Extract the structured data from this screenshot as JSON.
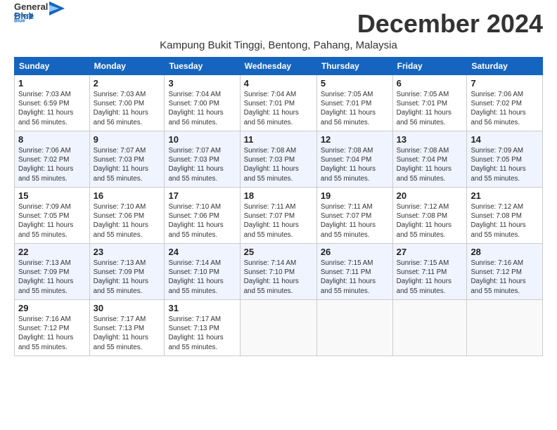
{
  "logo": {
    "general": "General",
    "blue": "Blue",
    "tagline": ""
  },
  "header": {
    "month_year": "December 2024",
    "location": "Kampung Bukit Tinggi, Bentong, Pahang, Malaysia"
  },
  "weekdays": [
    "Sunday",
    "Monday",
    "Tuesday",
    "Wednesday",
    "Thursday",
    "Friday",
    "Saturday"
  ],
  "weeks": [
    [
      {
        "day": "1",
        "info": "Sunrise: 7:03 AM\nSunset: 6:59 PM\nDaylight: 11 hours\nand 56 minutes."
      },
      {
        "day": "2",
        "info": "Sunrise: 7:03 AM\nSunset: 7:00 PM\nDaylight: 11 hours\nand 56 minutes."
      },
      {
        "day": "3",
        "info": "Sunrise: 7:04 AM\nSunset: 7:00 PM\nDaylight: 11 hours\nand 56 minutes."
      },
      {
        "day": "4",
        "info": "Sunrise: 7:04 AM\nSunset: 7:01 PM\nDaylight: 11 hours\nand 56 minutes."
      },
      {
        "day": "5",
        "info": "Sunrise: 7:05 AM\nSunset: 7:01 PM\nDaylight: 11 hours\nand 56 minutes."
      },
      {
        "day": "6",
        "info": "Sunrise: 7:05 AM\nSunset: 7:01 PM\nDaylight: 11 hours\nand 56 minutes."
      },
      {
        "day": "7",
        "info": "Sunrise: 7:06 AM\nSunset: 7:02 PM\nDaylight: 11 hours\nand 56 minutes."
      }
    ],
    [
      {
        "day": "8",
        "info": "Sunrise: 7:06 AM\nSunset: 7:02 PM\nDaylight: 11 hours\nand 55 minutes."
      },
      {
        "day": "9",
        "info": "Sunrise: 7:07 AM\nSunset: 7:03 PM\nDaylight: 11 hours\nand 55 minutes."
      },
      {
        "day": "10",
        "info": "Sunrise: 7:07 AM\nSunset: 7:03 PM\nDaylight: 11 hours\nand 55 minutes."
      },
      {
        "day": "11",
        "info": "Sunrise: 7:08 AM\nSunset: 7:03 PM\nDaylight: 11 hours\nand 55 minutes."
      },
      {
        "day": "12",
        "info": "Sunrise: 7:08 AM\nSunset: 7:04 PM\nDaylight: 11 hours\nand 55 minutes."
      },
      {
        "day": "13",
        "info": "Sunrise: 7:08 AM\nSunset: 7:04 PM\nDaylight: 11 hours\nand 55 minutes."
      },
      {
        "day": "14",
        "info": "Sunrise: 7:09 AM\nSunset: 7:05 PM\nDaylight: 11 hours\nand 55 minutes."
      }
    ],
    [
      {
        "day": "15",
        "info": "Sunrise: 7:09 AM\nSunset: 7:05 PM\nDaylight: 11 hours\nand 55 minutes."
      },
      {
        "day": "16",
        "info": "Sunrise: 7:10 AM\nSunset: 7:06 PM\nDaylight: 11 hours\nand 55 minutes."
      },
      {
        "day": "17",
        "info": "Sunrise: 7:10 AM\nSunset: 7:06 PM\nDaylight: 11 hours\nand 55 minutes."
      },
      {
        "day": "18",
        "info": "Sunrise: 7:11 AM\nSunset: 7:07 PM\nDaylight: 11 hours\nand 55 minutes."
      },
      {
        "day": "19",
        "info": "Sunrise: 7:11 AM\nSunset: 7:07 PM\nDaylight: 11 hours\nand 55 minutes."
      },
      {
        "day": "20",
        "info": "Sunrise: 7:12 AM\nSunset: 7:08 PM\nDaylight: 11 hours\nand 55 minutes."
      },
      {
        "day": "21",
        "info": "Sunrise: 7:12 AM\nSunset: 7:08 PM\nDaylight: 11 hours\nand 55 minutes."
      }
    ],
    [
      {
        "day": "22",
        "info": "Sunrise: 7:13 AM\nSunset: 7:09 PM\nDaylight: 11 hours\nand 55 minutes."
      },
      {
        "day": "23",
        "info": "Sunrise: 7:13 AM\nSunset: 7:09 PM\nDaylight: 11 hours\nand 55 minutes."
      },
      {
        "day": "24",
        "info": "Sunrise: 7:14 AM\nSunset: 7:10 PM\nDaylight: 11 hours\nand 55 minutes."
      },
      {
        "day": "25",
        "info": "Sunrise: 7:14 AM\nSunset: 7:10 PM\nDaylight: 11 hours\nand 55 minutes."
      },
      {
        "day": "26",
        "info": "Sunrise: 7:15 AM\nSunset: 7:11 PM\nDaylight: 11 hours\nand 55 minutes."
      },
      {
        "day": "27",
        "info": "Sunrise: 7:15 AM\nSunset: 7:11 PM\nDaylight: 11 hours\nand 55 minutes."
      },
      {
        "day": "28",
        "info": "Sunrise: 7:16 AM\nSunset: 7:12 PM\nDaylight: 11 hours\nand 55 minutes."
      }
    ],
    [
      {
        "day": "29",
        "info": "Sunrise: 7:16 AM\nSunset: 7:12 PM\nDaylight: 11 hours\nand 55 minutes."
      },
      {
        "day": "30",
        "info": "Sunrise: 7:17 AM\nSunset: 7:13 PM\nDaylight: 11 hours\nand 55 minutes."
      },
      {
        "day": "31",
        "info": "Sunrise: 7:17 AM\nSunset: 7:13 PM\nDaylight: 11 hours\nand 55 minutes."
      },
      null,
      null,
      null,
      null
    ]
  ]
}
